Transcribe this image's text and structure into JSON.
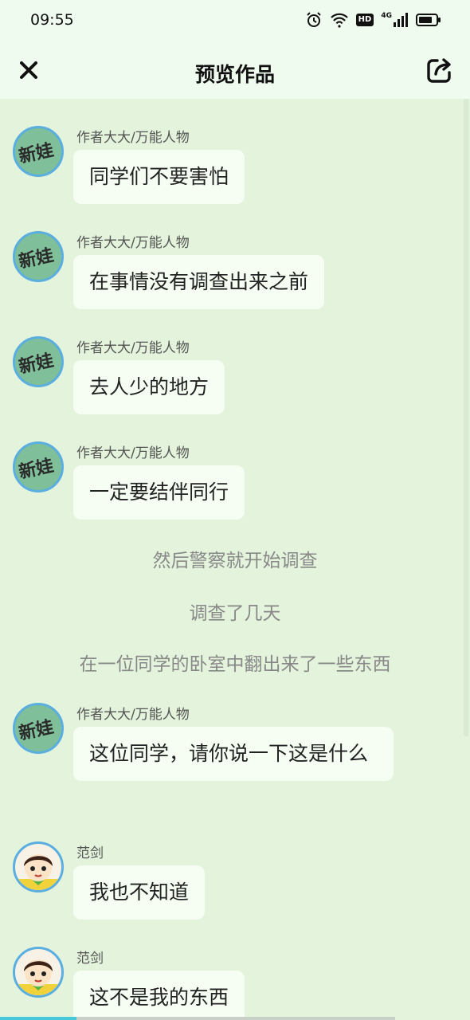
{
  "status": {
    "time": "09:55",
    "hd_label": "HD",
    "net_label": "4G"
  },
  "header": {
    "title": "预览作品"
  },
  "messages": [
    {
      "sender": "作者大大/万能人物",
      "text": "同学们不要害怕",
      "avatar_text": "新娃"
    },
    {
      "sender": "作者大大/万能人物",
      "text": "在事情没有调查出来之前",
      "avatar_text": "新娃"
    },
    {
      "sender": "作者大大/万能人物",
      "text": "去人少的地方",
      "avatar_text": "新娃"
    },
    {
      "sender": "作者大大/万能人物",
      "text": "一定要结伴同行",
      "avatar_text": "新娃"
    },
    {
      "sender": "作者大大/万能人物",
      "text": "这位同学，请你说一下这是什么",
      "avatar_text": "新娃"
    },
    {
      "sender": "范剑",
      "text": "我也不知道"
    },
    {
      "sender": "范剑",
      "text": "这不是我的东西"
    }
  ],
  "narrations": [
    "然后警察就开始调查",
    "调查了几天",
    "在一位同学的卧室中翻出来了一些东西"
  ],
  "colors": {
    "background": "#e3f3dc",
    "bubble": "#f6fdf3",
    "avatar_ring": "#5aaee0",
    "accent": "#46c8d8"
  }
}
